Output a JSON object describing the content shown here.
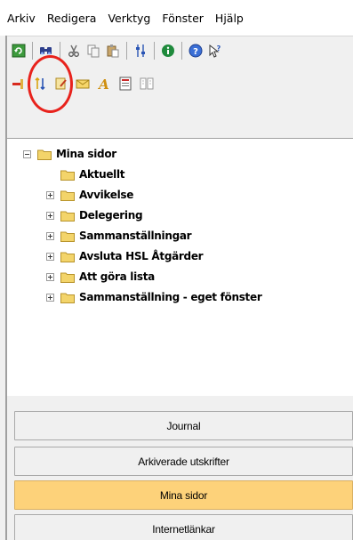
{
  "menu": {
    "items": [
      "Arkiv",
      "Redigera",
      "Verktyg",
      "Fönster",
      "Hjälp"
    ]
  },
  "toolbar": {
    "row1_icons": [
      "refresh-icon",
      "find-icon",
      "cut-icon",
      "copy-icon",
      "paste-icon",
      "properties-icon",
      "info-icon",
      "help-icon",
      "whats-this-icon"
    ],
    "row2_icons": [
      "remove-icon",
      "sort-icon",
      "edit-icon",
      "mail-icon",
      "font-icon",
      "form-icon",
      "book-icon"
    ]
  },
  "tree": {
    "root": "Mina sidor",
    "children": [
      {
        "label": "Aktuellt",
        "expandable": false
      },
      {
        "label": "Avvikelse",
        "expandable": true
      },
      {
        "label": "Delegering",
        "expandable": true
      },
      {
        "label": "Sammanställningar",
        "expandable": true
      },
      {
        "label": "Avsluta HSL Åtgärder",
        "expandable": true
      },
      {
        "label": "Att göra lista",
        "expandable": true
      },
      {
        "label": "Sammanställning - eget fönster",
        "expandable": true
      }
    ]
  },
  "nav_buttons": [
    {
      "label": "Journal",
      "active": false
    },
    {
      "label": "Arkiverade utskrifter",
      "active": false
    },
    {
      "label": "Mina sidor",
      "active": true
    },
    {
      "label": "Internetlänkar",
      "active": false
    }
  ],
  "colors": {
    "active_button": "#fdd27a",
    "annotation": "#e8221c",
    "folder": "#f3d46a"
  }
}
